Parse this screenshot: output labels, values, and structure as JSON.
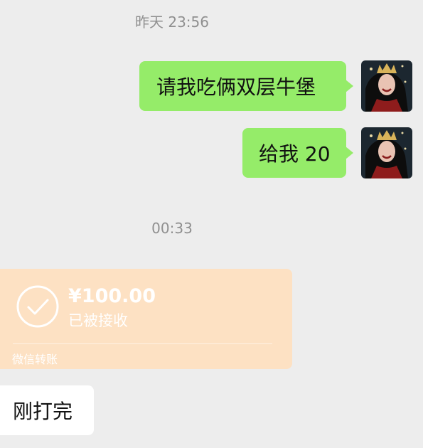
{
  "timestamps": [
    "昨天 23:56",
    "00:33"
  ],
  "messages": {
    "sent_1": "请我吃俩双层牛堡",
    "sent_2": "给我 20",
    "received_1": "刚打完"
  },
  "transfer": {
    "amount": "¥100.00",
    "status": "已被接收",
    "label": "微信转账"
  },
  "colors": {
    "background": "#ededed",
    "sent_bubble": "#95ec69",
    "received_bubble": "#ffffff",
    "transfer_card": "#fde1c3",
    "timestamp_text": "#8f8f8f"
  },
  "icons": {
    "transfer": "checkmark-circle-icon",
    "avatar": "user-avatar"
  }
}
